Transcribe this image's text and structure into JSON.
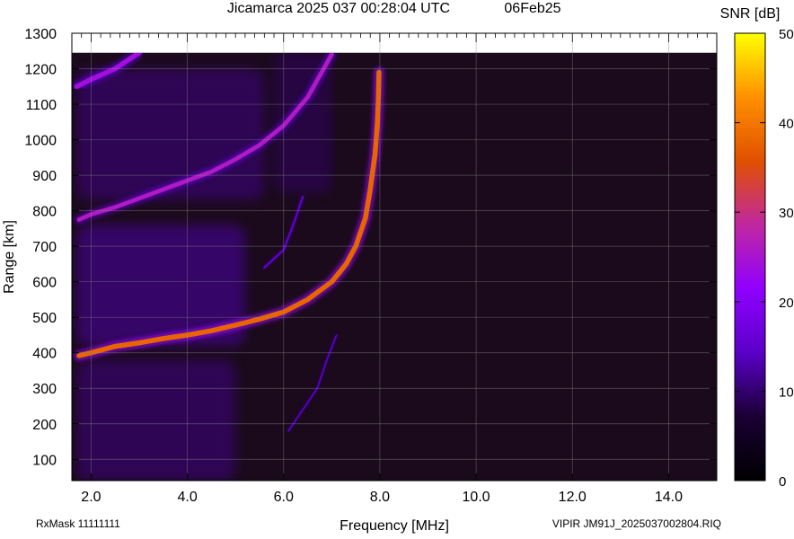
{
  "chart_data": {
    "type": "heatmap",
    "title": "Jicamarca 2025 037 00:28:04 UTC",
    "date": "06Feb25",
    "xlabel": "Frequency [MHz]",
    "ylabel": "Range [km]",
    "xlim": [
      1.6,
      15.0
    ],
    "ylim": [
      40,
      1300
    ],
    "data_ylim": [
      40,
      1245
    ],
    "x_ticks": [
      2.0,
      4.0,
      6.0,
      8.0,
      10.0,
      12.0,
      14.0
    ],
    "x_tick_labels": [
      "2.0",
      "4.0",
      "6.0",
      "8.0",
      "10.0",
      "12.0",
      "14.0"
    ],
    "y_ticks": [
      100,
      200,
      300,
      400,
      500,
      600,
      700,
      800,
      900,
      1000,
      1100,
      1200,
      1300
    ],
    "y_tick_labels": [
      "100",
      "200",
      "300",
      "400",
      "500",
      "600",
      "700",
      "800",
      "900",
      "1000",
      "1100",
      "1200",
      "1300"
    ],
    "grid": true,
    "colorbar": {
      "label": "SNR [dB]",
      "range": [
        0,
        50
      ],
      "ticks": [
        0,
        10,
        20,
        30,
        40,
        50
      ],
      "tick_labels": [
        "0",
        "10",
        "20",
        "30",
        "40",
        "50"
      ],
      "colormap": [
        "#000000",
        "#1a0033",
        "#5a00c8",
        "#9000ff",
        "#c028a0",
        "#e05000",
        "#ff9000",
        "#ffff00"
      ]
    },
    "background_color": "#1b0a1c",
    "traces": [
      {
        "name": "",
        "snr": 38,
        "width_km": 14,
        "points": [
          [
            1.75,
            392
          ],
          [
            2.0,
            400
          ],
          [
            2.5,
            418
          ],
          [
            3.0,
            428
          ],
          [
            3.5,
            440
          ],
          [
            4.0,
            450
          ],
          [
            4.5,
            462
          ],
          [
            5.0,
            478
          ],
          [
            5.5,
            495
          ],
          [
            6.0,
            515
          ],
          [
            6.5,
            550
          ],
          [
            7.0,
            600
          ],
          [
            7.3,
            650
          ],
          [
            7.5,
            700
          ],
          [
            7.7,
            780
          ],
          [
            7.8,
            860
          ],
          [
            7.9,
            960
          ],
          [
            7.95,
            1050
          ],
          [
            7.97,
            1120
          ],
          [
            7.98,
            1190
          ]
        ]
      },
      {
        "name": "",
        "snr": 26,
        "width_km": 12,
        "points": [
          [
            1.75,
            775
          ],
          [
            2.0,
            790
          ],
          [
            2.5,
            810
          ],
          [
            3.0,
            835
          ],
          [
            3.5,
            860
          ],
          [
            4.0,
            885
          ],
          [
            4.5,
            910
          ],
          [
            5.0,
            945
          ],
          [
            5.5,
            985
          ],
          [
            6.0,
            1040
          ],
          [
            6.5,
            1120
          ],
          [
            7.0,
            1240
          ]
        ]
      },
      {
        "name": "",
        "snr": 24,
        "width_km": 14,
        "points": [
          [
            1.7,
            1150
          ],
          [
            2.0,
            1170
          ],
          [
            2.5,
            1200
          ],
          [
            3.0,
            1245
          ]
        ]
      },
      {
        "name": "",
        "snr": 15,
        "width_km": 6,
        "points": [
          [
            5.6,
            640
          ],
          [
            6.0,
            690
          ],
          [
            6.2,
            760
          ],
          [
            6.4,
            840
          ]
        ]
      },
      {
        "name": "",
        "snr": 14,
        "width_km": 5,
        "points": [
          [
            6.1,
            180
          ],
          [
            6.4,
            240
          ],
          [
            6.7,
            300
          ],
          [
            6.9,
            380
          ],
          [
            7.1,
            450
          ]
        ]
      }
    ],
    "diffuse_regions": [
      {
        "x_range": [
          1.7,
          5.0
        ],
        "y_range": [
          40,
          380
        ],
        "snr": 12
      },
      {
        "x_range": [
          1.7,
          5.2
        ],
        "y_range": [
          420,
          760
        ],
        "snr": 14
      },
      {
        "x_range": [
          1.7,
          5.6
        ],
        "y_range": [
          830,
          1200
        ],
        "snr": 12
      },
      {
        "x_range": [
          5.8,
          7.0
        ],
        "y_range": [
          850,
          1245
        ],
        "snr": 10
      }
    ],
    "footer": {
      "left": "RxMask 11111111",
      "right": "VIPIR  JM91J_2025037002804.RIQ"
    }
  }
}
